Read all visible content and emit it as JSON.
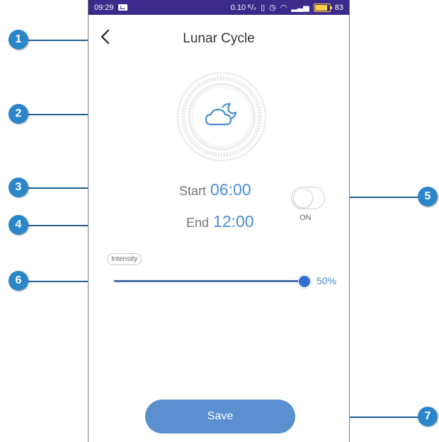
{
  "status_bar": {
    "time": "09:29",
    "network_speed": "0.10 ᴷ/ₛ",
    "battery": "83"
  },
  "header": {
    "title": "Lunar Cycle",
    "back_icon": "chevron-left-icon"
  },
  "mode_icon": "moon-cloud-icon",
  "schedule": {
    "start_label": "Start",
    "start_time": "06:00",
    "end_label": "End",
    "end_time": "12:00"
  },
  "toggle": {
    "label": "ON"
  },
  "intensity": {
    "label": "Intensity",
    "value": "50%",
    "level": 0.5
  },
  "save_label": "Save",
  "callouts": [
    "1",
    "2",
    "3",
    "4",
    "5",
    "6",
    "7"
  ],
  "colors": {
    "status_bar": "#3b2a8a",
    "accent": "#4a8fd6",
    "button": "#5a8fd0",
    "callout": "#2a86c9"
  }
}
